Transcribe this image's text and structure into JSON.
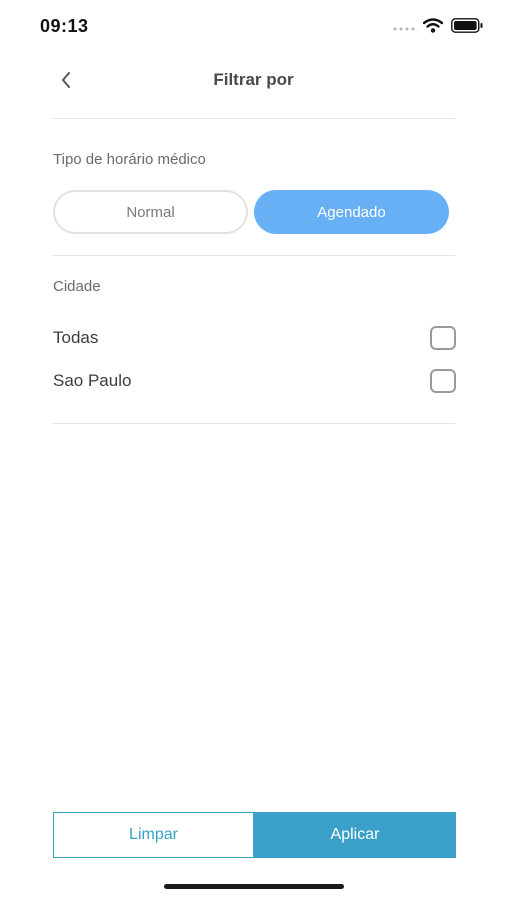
{
  "status_bar": {
    "time": "09:13",
    "icons": [
      "signal-dots-icon",
      "wifi-icon",
      "battery-icon"
    ]
  },
  "header": {
    "title": "Filtrar por",
    "back_icon": "chevron-left-icon"
  },
  "schedule_type": {
    "label": "Tipo de horário médico",
    "options": [
      "Normal",
      "Agendado"
    ],
    "selected": "Agendado"
  },
  "city": {
    "label": "Cidade",
    "options": [
      {
        "label": "Todas",
        "checked": false
      },
      {
        "label": "Sao Paulo",
        "checked": false
      }
    ]
  },
  "footer": {
    "clear_label": "Limpar",
    "apply_label": "Aplicar"
  },
  "colors": {
    "selected_segment": "#67b0f5",
    "primary_button": "#3aa0c8",
    "divider": "#e3e3e3"
  }
}
